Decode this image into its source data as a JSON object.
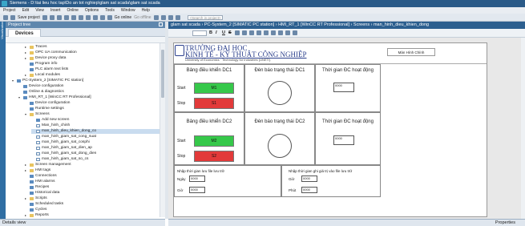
{
  "window": {
    "title": "Siemens - D:\\tai lieu hoc tap\\Do an tot nghiep\\glam sat scada\\glam sat scada"
  },
  "menu": [
    "Project",
    "Edit",
    "View",
    "Insert",
    "Online",
    "Options",
    "Tools",
    "Window",
    "Help"
  ],
  "toolbar": {
    "save_label": "Save project",
    "go_online": "Go online",
    "go_offline": "Go offline",
    "search_placeholder": "<Search in project>"
  },
  "left_strip_label": "Visualization",
  "project_tree": {
    "title": "Project tree",
    "tab": "Devices",
    "items": [
      {
        "label": "Traces",
        "indent": 3,
        "icon": "folder",
        "arrow": "▸"
      },
      {
        "label": "OPC UA communication",
        "indent": 3,
        "icon": "folder",
        "arrow": "▸"
      },
      {
        "label": "Device proxy data",
        "indent": 3,
        "icon": "folder",
        "arrow": "▸"
      },
      {
        "label": "Program info",
        "indent": 3,
        "icon": "doc",
        "arrow": ""
      },
      {
        "label": "PLC alarm text lists",
        "indent": 3,
        "icon": "doc",
        "arrow": ""
      },
      {
        "label": "Local modules",
        "indent": 3,
        "icon": "folder",
        "arrow": "▸"
      },
      {
        "label": "PC-System_2 [SIMATIC PC station]",
        "indent": 1,
        "icon": "doc",
        "arrow": "▾"
      },
      {
        "label": "Device configuration",
        "indent": 2,
        "icon": "doc",
        "arrow": ""
      },
      {
        "label": "Online & diagnostics",
        "indent": 2,
        "icon": "doc",
        "arrow": ""
      },
      {
        "label": "HMI_RT_1 [WinCC RT Professional]",
        "indent": 2,
        "icon": "doc",
        "arrow": "▾"
      },
      {
        "label": "Device configuration",
        "indent": 3,
        "icon": "doc",
        "arrow": ""
      },
      {
        "label": "Runtime settings",
        "indent": 3,
        "icon": "doc",
        "arrow": ""
      },
      {
        "label": "Screens",
        "indent": 3,
        "icon": "folder",
        "arrow": "▾"
      },
      {
        "label": "Add new screen",
        "indent": 4,
        "icon": "doc",
        "arrow": ""
      },
      {
        "label": "Man_hinh_chinh",
        "indent": 4,
        "icon": "page",
        "arrow": ""
      },
      {
        "label": "man_hinh_dieu_khien_dong_co",
        "indent": 4,
        "icon": "page",
        "arrow": "",
        "selected": true
      },
      {
        "label": "man_hinh_giam_sat_cong_suat",
        "indent": 4,
        "icon": "page",
        "arrow": ""
      },
      {
        "label": "man_hinh_giam_sat_cosphi",
        "indent": 4,
        "icon": "page",
        "arrow": ""
      },
      {
        "label": "man_hinh_giam_sat_dien_ap",
        "indent": 4,
        "icon": "page",
        "arrow": ""
      },
      {
        "label": "man_hinh_giam_sat_dong_dien",
        "indent": 4,
        "icon": "page",
        "arrow": ""
      },
      {
        "label": "man_hinh_giam_sat_so_cs",
        "indent": 4,
        "icon": "page",
        "arrow": ""
      },
      {
        "label": "Screen management",
        "indent": 3,
        "icon": "folder",
        "arrow": "▸"
      },
      {
        "label": "HMI tags",
        "indent": 3,
        "icon": "folder",
        "arrow": "▸"
      },
      {
        "label": "Connections",
        "indent": 3,
        "icon": "doc",
        "arrow": ""
      },
      {
        "label": "HMI alarms",
        "indent": 3,
        "icon": "doc",
        "arrow": ""
      },
      {
        "label": "Recipes",
        "indent": 3,
        "icon": "doc",
        "arrow": ""
      },
      {
        "label": "Historical data",
        "indent": 3,
        "icon": "doc",
        "arrow": ""
      },
      {
        "label": "Scripts",
        "indent": 3,
        "icon": "folder",
        "arrow": "▸"
      },
      {
        "label": "Scheduled tasks",
        "indent": 3,
        "icon": "doc",
        "arrow": ""
      },
      {
        "label": "Cycles",
        "indent": 3,
        "icon": "doc",
        "arrow": ""
      },
      {
        "label": "Reports",
        "indent": 3,
        "icon": "folder",
        "arrow": "▸"
      }
    ]
  },
  "details_view": "Details view",
  "breadcrumb": "glam sat scada  ›  PC-System_2 [SIMATIC PC station]  ›  HMI_RT_1 [WinCC RT Professional]  ›  Screens  ›  man_hinh_dieu_khien_dong",
  "screen": {
    "university_line1": "TRƯỜNG ĐẠI HỌC",
    "university_line2": "KINH TẾ - KỸ THUẬT CÔNG NGHIỆP",
    "university_line3": "University of Economics · Technology for Industries (UNETI)",
    "main_screen_button": "Màn Hình Chính",
    "panel1": {
      "title": "Bảng điều khiển DC1",
      "start_label": "Start",
      "stop_label": "Stop",
      "on_btn": "M1",
      "off_btn": "S1"
    },
    "lamp1_title": "Đèn báo trạng thái DC1",
    "time1_title": "Thời gian ĐC hoạt động",
    "panel2": {
      "title": "Bảng điều khiển DC2",
      "start_label": "Start",
      "stop_label": "Stop",
      "on_btn": "M2",
      "off_btn": "S2"
    },
    "lamp2_title": "Đèn báo trạng thái DC2",
    "time2_title": "Thời gian ĐC hoạt động",
    "bottom_left_title": "Nhập thời gian lưu file lưu trữ",
    "bottom_left_fields": [
      "Ngày",
      "Giờ"
    ],
    "bottom_right_title": "Nhập thời gian ghi giá trị vào file lưu trữ",
    "bottom_right_fields": [
      "Giờ",
      "Phút"
    ],
    "io_placeholder": "0000"
  },
  "properties_label": "Properties",
  "colors": {
    "start": "#36c84a",
    "stop": "#e23a3a",
    "title_bar": "#2a5a88"
  }
}
